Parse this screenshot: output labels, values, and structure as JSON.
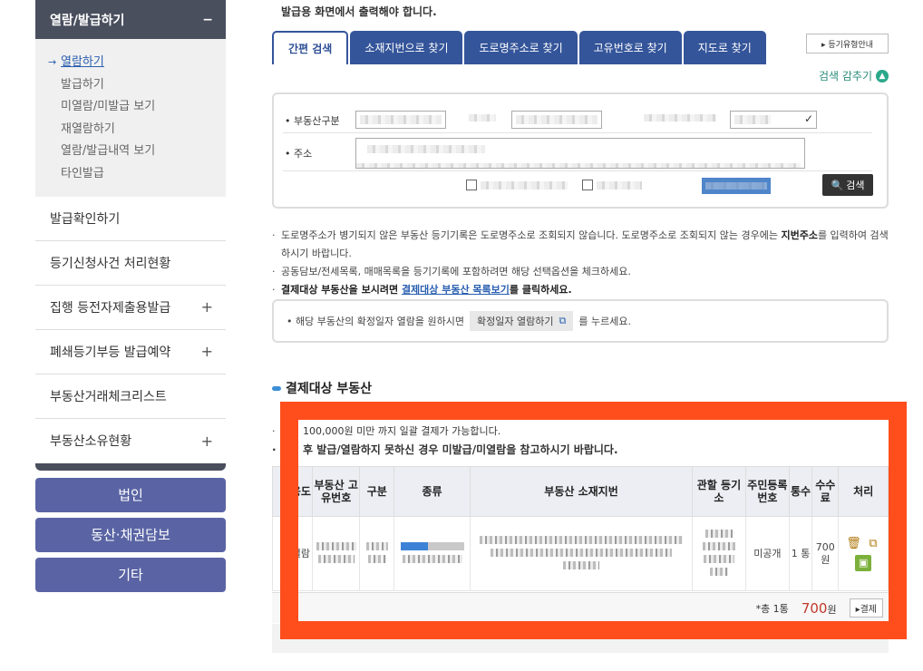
{
  "sidebar": {
    "head": "열람/발급하기",
    "head_toggle": "−",
    "sub_items": [
      "열람하기",
      "발급하기",
      "미열람/미발급 보기",
      "재열람하기",
      "열람/발급내역 보기",
      "타인발급"
    ],
    "items": [
      {
        "label": "발급확인하기",
        "plus": ""
      },
      {
        "label": "등기신청사건 처리현황",
        "plus": ""
      },
      {
        "label": "집행 등전자제출용발급",
        "plus": "+"
      },
      {
        "label": "폐쇄등기부등 발급예약",
        "plus": "+"
      },
      {
        "label": "부동산거래체크리스트",
        "plus": ""
      },
      {
        "label": "부동산소유현황",
        "plus": "+"
      }
    ],
    "buttons": [
      "법인",
      "동산·채권담보",
      "기타"
    ]
  },
  "main": {
    "top_note": "발급용 화면에서 출력해야 합니다.",
    "tabs": [
      "간편 검색",
      "소재지번으로 찾기",
      "도로명주소로 찾기",
      "고유번호로 찾기",
      "지도로 찾기"
    ],
    "tab_guide": "▸ 등기유형안내",
    "hide_search": "검색 감추기",
    "search": {
      "label_type": "• 부동산구분",
      "label_addr": "• 주소",
      "search_btn": "검색"
    },
    "notes": [
      {
        "text": "도로명주소가 병기되지 않은 부동산 등기기록은 도로명주소로 조회되지 않습니다. 도로명주소로 조회되지 않는 경우에는 ",
        "bold": "지번주소",
        "text2": "를 입력하여 검색하시기 바랍니다."
      },
      {
        "text": "공동담보/전세목록, 매매목록을 등기기록에 포함하려면 해당 선택옵션을 체크하세요."
      },
      {
        "text": "결제대상 부동산을 보시려면 ",
        "link": "결제대상 부동산 목록보기",
        "text2": "를 클릭하세요."
      }
    ],
    "info": {
      "before": "• 해당 부동산의 확정일자 열람을 원하시면",
      "button": "확정일자 열람하기",
      "after": "를 누르세요."
    },
    "section_title": "결제대상 부동산",
    "pay_notes": [
      "100,000원 미만 까지 일괄 결제가 가능합니다.",
      "후 발급/열람하지 못하신 경우 미발급/미열람을 참고하시기 바랍니다."
    ],
    "table": {
      "headers": [
        "",
        "용도",
        "부동산 고유번호",
        "구분",
        "종류",
        "부동산 소재지번",
        "관할 등기소",
        "주민등록번호",
        "통수",
        "수수료",
        "처리"
      ],
      "row": {
        "use": "열람",
        "resident": "미공개",
        "count": "1 통",
        "fee": "700 원"
      }
    },
    "summary": {
      "total": "*총 1통",
      "price": "700",
      "won": "원",
      "pay": "▸결제"
    }
  }
}
